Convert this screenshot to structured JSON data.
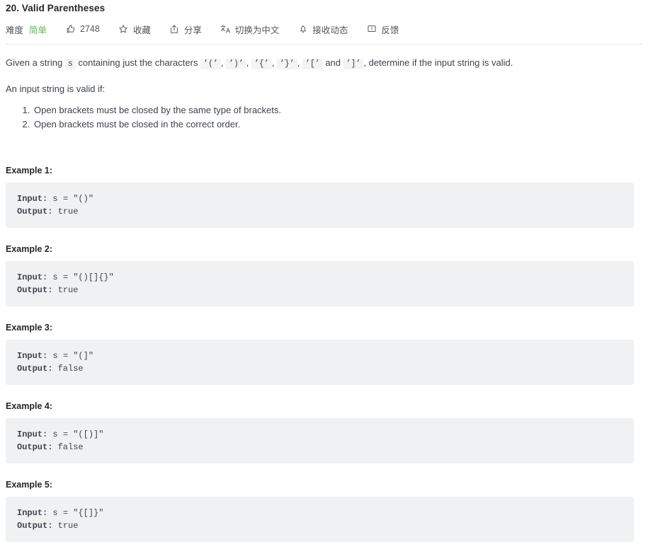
{
  "problem": {
    "title": "20. Valid Parentheses"
  },
  "meta": {
    "difficulty_label": "难度",
    "difficulty_value": "简单",
    "likes_icon": "thumbs-up-icon",
    "likes_count": "2748",
    "favorite_icon": "star-icon",
    "favorite_label": "收藏",
    "share_icon": "share-icon",
    "share_label": "分享",
    "translate_icon": "translate-icon",
    "translate_label": "切换为中文",
    "subscribe_icon": "bell-icon",
    "subscribe_label": "接收动态",
    "feedback_icon": "comment-icon",
    "feedback_label": "反馈",
    "difficulty_color": "#5cb85c"
  },
  "description": {
    "intro_part1": "Given a string",
    "intro_code_s": "s",
    "intro_part2": "containing just the characters",
    "chars": [
      "’(’",
      "’)’",
      "’{’",
      "’}’",
      "’[’",
      "’]’"
    ],
    "intro_sep_comma": ",",
    "intro_and": "and",
    "intro_part3": ", determine if the input string is valid.",
    "valid_if": "An input string is valid if:",
    "rules": [
      "Open brackets must be closed by the same type of brackets.",
      "Open brackets must be closed in the correct order."
    ]
  },
  "examples": [
    {
      "title": "Example 1:",
      "input": "Input: ",
      "input_value": "s = \"()\"",
      "output": "Output: ",
      "output_value": "true"
    },
    {
      "title": "Example 2:",
      "input": "Input: ",
      "input_value": "s = \"()[]{}\"",
      "output": "Output: ",
      "output_value": "true"
    },
    {
      "title": "Example 3:",
      "input": "Input: ",
      "input_value": "s = \"(]\"",
      "output": "Output: ",
      "output_value": "false"
    },
    {
      "title": "Example 4:",
      "input": "Input: ",
      "input_value": "s = \"([)]\"",
      "output": "Output: ",
      "output_value": "false"
    },
    {
      "title": "Example 5:",
      "input": "Input: ",
      "input_value": "s = \"{[]}\"",
      "output": "Output: ",
      "output_value": "true"
    }
  ]
}
